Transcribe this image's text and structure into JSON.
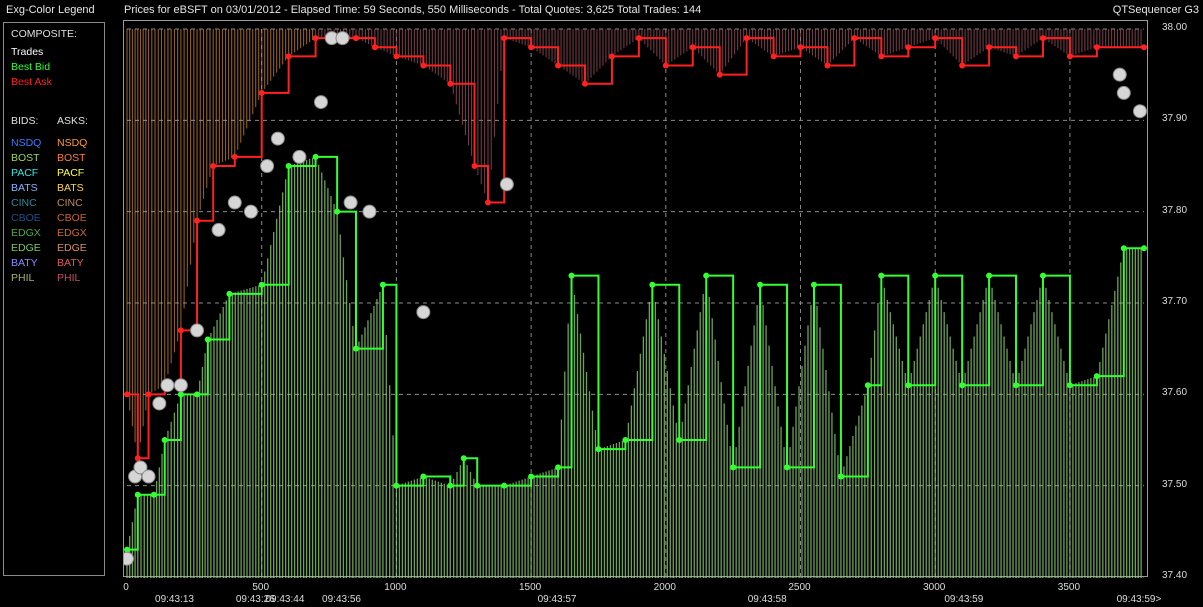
{
  "window": {
    "legend_title": "Exg-Color Legend",
    "chart_title": "Prices for  eBSFT  on  03/01/2012  -  Elapsed Time: 59 Seconds, 550 Milliseconds  -  Total Quotes: 3,625  Total Trades: 144",
    "app_name": "QTSequencer G3"
  },
  "legend": {
    "composite_header": "COMPOSITE:",
    "composite": [
      {
        "label": "Trades",
        "color": "#ffffff"
      },
      {
        "label": "Best Bid",
        "color": "#33ff33"
      },
      {
        "label": "Best Ask",
        "color": "#ff2020"
      }
    ],
    "bids_header": "BIDS:",
    "asks_header": "ASKS:",
    "exchanges": [
      {
        "bid": "NSDQ",
        "ask": "NSDQ",
        "bid_color": "#3b7bff",
        "ask_color": "#ff9a2e"
      },
      {
        "bid": "BOST",
        "ask": "BOST",
        "bid_color": "#9ad85a",
        "ask_color": "#ff7a3a"
      },
      {
        "bid": "PACF",
        "ask": "PACF",
        "bid_color": "#2ee8e8",
        "ask_color": "#ffff40"
      },
      {
        "bid": "BATS",
        "ask": "BATS",
        "bid_color": "#7fb4ff",
        "ask_color": "#ffd34a"
      },
      {
        "bid": "CINC",
        "ask": "CINC",
        "bid_color": "#2a8a9a",
        "ask_color": "#c08a5a"
      },
      {
        "bid": "CBOE",
        "ask": "CBOE",
        "bid_color": "#1c4f8a",
        "ask_color": "#c8642a"
      },
      {
        "bid": "EDGX",
        "ask": "EDGX",
        "bid_color": "#4ca848",
        "ask_color": "#c86a3a"
      },
      {
        "bid": "EDGE",
        "ask": "EDGE",
        "bid_color": "#7cc86a",
        "ask_color": "#d88a6a"
      },
      {
        "bid": "BATY",
        "ask": "BATY",
        "bid_color": "#8a8aff",
        "ask_color": "#e05a5a"
      },
      {
        "bid": "PHIL",
        "ask": "PHIL",
        "bid_color": "#a8b060",
        "ask_color": "#c84a6a"
      }
    ]
  },
  "chart_data": {
    "type": "line",
    "x_quote_ticks": [
      "0",
      "500",
      "1000",
      "1500",
      "2000",
      "2500",
      "3000",
      "3500"
    ],
    "x_quote_values": [
      0,
      500,
      1000,
      1500,
      2000,
      2500,
      3000,
      3500
    ],
    "x_time_labels": [
      {
        "label": "09:43:13",
        "x": 180
      },
      {
        "label": "09:43:26",
        "x": 480
      },
      {
        "label": "09:43:44",
        "x": 590
      },
      {
        "label": "09:43:56",
        "x": 800
      },
      {
        "label": "09:43:57",
        "x": 1600
      },
      {
        "label": "09:43:58",
        "x": 2380
      },
      {
        "label": "09:43:59",
        "x": 3110
      },
      {
        "label": "09:43:59>",
        "x": 3760
      }
    ],
    "xlim": [
      0,
      3775
    ],
    "y_ticks": [
      "38.00",
      "37.90",
      "37.80",
      "37.70",
      "37.60",
      "37.50",
      "37.40"
    ],
    "y_values": [
      38.0,
      37.9,
      37.8,
      37.7,
      37.6,
      37.5,
      37.4
    ],
    "ylim": [
      37.4,
      38.0
    ],
    "grid": true,
    "series": [
      {
        "name": "Best Ask",
        "color": "#ff2020",
        "points": [
          [
            0,
            37.6
          ],
          [
            40,
            37.53
          ],
          [
            80,
            37.6
          ],
          [
            140,
            37.61
          ],
          [
            200,
            37.67
          ],
          [
            260,
            37.79
          ],
          [
            320,
            37.85
          ],
          [
            400,
            37.86
          ],
          [
            500,
            37.93
          ],
          [
            600,
            37.97
          ],
          [
            700,
            37.99
          ],
          [
            850,
            37.99
          ],
          [
            920,
            37.98
          ],
          [
            1000,
            37.97
          ],
          [
            1100,
            37.96
          ],
          [
            1200,
            37.94
          ],
          [
            1290,
            37.85
          ],
          [
            1340,
            37.81
          ],
          [
            1400,
            37.99
          ],
          [
            1500,
            37.98
          ],
          [
            1600,
            37.96
          ],
          [
            1700,
            37.94
          ],
          [
            1800,
            37.97
          ],
          [
            1900,
            37.99
          ],
          [
            2000,
            37.96
          ],
          [
            2100,
            37.98
          ],
          [
            2200,
            37.95
          ],
          [
            2300,
            37.99
          ],
          [
            2400,
            37.97
          ],
          [
            2500,
            37.98
          ],
          [
            2600,
            37.96
          ],
          [
            2700,
            37.99
          ],
          [
            2800,
            37.97
          ],
          [
            2900,
            37.98
          ],
          [
            3000,
            37.99
          ],
          [
            3100,
            37.96
          ],
          [
            3200,
            37.98
          ],
          [
            3300,
            37.97
          ],
          [
            3400,
            37.99
          ],
          [
            3500,
            37.97
          ],
          [
            3600,
            37.98
          ],
          [
            3775,
            37.98
          ]
        ]
      },
      {
        "name": "Best Bid",
        "color": "#33ff33",
        "points": [
          [
            0,
            37.43
          ],
          [
            40,
            37.49
          ],
          [
            100,
            37.49
          ],
          [
            140,
            37.55
          ],
          [
            200,
            37.6
          ],
          [
            260,
            37.6
          ],
          [
            300,
            37.66
          ],
          [
            380,
            37.71
          ],
          [
            500,
            37.72
          ],
          [
            600,
            37.85
          ],
          [
            700,
            37.86
          ],
          [
            780,
            37.8
          ],
          [
            850,
            37.65
          ],
          [
            950,
            37.72
          ],
          [
            1000,
            37.5
          ],
          [
            1100,
            37.51
          ],
          [
            1200,
            37.5
          ],
          [
            1250,
            37.53
          ],
          [
            1300,
            37.5
          ],
          [
            1400,
            37.5
          ],
          [
            1500,
            37.51
          ],
          [
            1600,
            37.52
          ],
          [
            1650,
            37.73
          ],
          [
            1750,
            37.54
          ],
          [
            1850,
            37.55
          ],
          [
            1950,
            37.72
          ],
          [
            2050,
            37.55
          ],
          [
            2150,
            37.73
          ],
          [
            2250,
            37.52
          ],
          [
            2350,
            37.72
          ],
          [
            2450,
            37.52
          ],
          [
            2550,
            37.72
          ],
          [
            2650,
            37.51
          ],
          [
            2750,
            37.61
          ],
          [
            2800,
            37.73
          ],
          [
            2900,
            37.61
          ],
          [
            3000,
            37.73
          ],
          [
            3100,
            37.61
          ],
          [
            3200,
            37.73
          ],
          [
            3300,
            37.61
          ],
          [
            3400,
            37.73
          ],
          [
            3500,
            37.61
          ],
          [
            3600,
            37.62
          ],
          [
            3700,
            37.76
          ],
          [
            3775,
            37.76
          ]
        ]
      },
      {
        "name": "Trades",
        "color": "#d0d0d0",
        "points": [
          [
            0,
            37.42
          ],
          [
            30,
            37.51
          ],
          [
            50,
            37.52
          ],
          [
            80,
            37.51
          ],
          [
            120,
            37.59
          ],
          [
            150,
            37.61
          ],
          [
            200,
            37.61
          ],
          [
            260,
            37.67
          ],
          [
            340,
            37.78
          ],
          [
            400,
            37.81
          ],
          [
            460,
            37.8
          ],
          [
            520,
            37.85
          ],
          [
            560,
            37.88
          ],
          [
            640,
            37.86
          ],
          [
            720,
            37.92
          ],
          [
            760,
            37.99
          ],
          [
            800,
            37.99
          ],
          [
            830,
            37.81
          ],
          [
            900,
            37.8
          ],
          [
            1100,
            37.69
          ],
          [
            1410,
            37.83
          ],
          [
            3685,
            37.95
          ],
          [
            3700,
            37.93
          ],
          [
            3760,
            37.91
          ]
        ]
      }
    ]
  }
}
